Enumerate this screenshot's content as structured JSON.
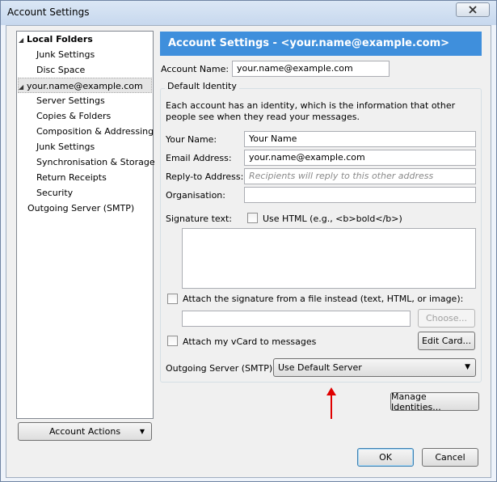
{
  "window": {
    "title": "Account Settings"
  },
  "tree": {
    "local_folders": "Local Folders",
    "junk_settings_local": "Junk Settings",
    "disc_space": "Disc Space",
    "account": "your.name@example.com",
    "server_settings": "Server Settings",
    "copies_folders": "Copies & Folders",
    "composition": "Composition & Addressing",
    "junk_settings": "Junk Settings",
    "sync_storage": "Synchronisation & Storage",
    "return_receipts": "Return Receipts",
    "security": "Security",
    "outgoing_server": "Outgoing Server (SMTP)",
    "account_actions": "Account Actions"
  },
  "pane": {
    "header": "Account Settings - <your.name@example.com>",
    "account_name_label": "Account Name:",
    "account_name_value": "your.name@example.com",
    "default_identity": "Default Identity",
    "identity_desc": "Each account has an identity, which is the information that other people see when they read your messages.",
    "your_name_label": "Your Name:",
    "your_name_value": "Your Name",
    "email_label": "Email Address:",
    "email_value": "your.name@example.com",
    "reply_to_label": "Reply-to Address:",
    "reply_to_placeholder": "Recipients will reply to this other address",
    "organisation_label": "Organisation:",
    "organisation_value": "",
    "signature_label": "Signature text:",
    "use_html_label": "Use HTML (e.g., <b>bold</b>)",
    "attach_sig_label": "Attach the signature from a file instead (text, HTML, or image):",
    "choose_label": "Choose...",
    "attach_vcard_label": "Attach my vCard to messages",
    "edit_card_label": "Edit Card...",
    "outgoing_label": "Outgoing Server (SMTP):",
    "outgoing_value": "Use Default Server",
    "manage_identities": "Manage Identities..."
  },
  "footer": {
    "ok": "OK",
    "cancel": "Cancel"
  },
  "colors": {
    "header_bg": "#3f8fdc",
    "annotation_arrow": "#e00000"
  }
}
